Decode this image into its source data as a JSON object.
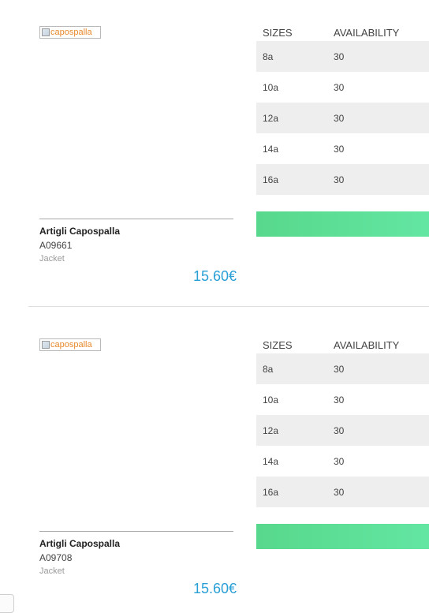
{
  "products": [
    {
      "image_alt": "capospalla",
      "table_headers": {
        "size": "SIZES",
        "availability": "AVAILABILITY"
      },
      "rows": [
        {
          "size": "8a",
          "availability": "30"
        },
        {
          "size": "10a",
          "availability": "30"
        },
        {
          "size": "12a",
          "availability": "30"
        },
        {
          "size": "14a",
          "availability": "30"
        },
        {
          "size": "16a",
          "availability": "30"
        }
      ],
      "name": "Artigli Capospalla",
      "code": "A09661",
      "category": "Jacket",
      "price": "15.60€"
    },
    {
      "image_alt": "capospalla",
      "table_headers": {
        "size": "SIZES",
        "availability": "AVAILABILITY"
      },
      "rows": [
        {
          "size": "8a",
          "availability": "30"
        },
        {
          "size": "10a",
          "availability": "30"
        },
        {
          "size": "12a",
          "availability": "30"
        },
        {
          "size": "14a",
          "availability": "30"
        },
        {
          "size": "16a",
          "availability": "30"
        }
      ],
      "name": "Artigli Capospalla",
      "code": "A09708",
      "category": "Jacket",
      "price": "15.60€"
    }
  ],
  "colors": {
    "price": "#2a9fd6",
    "order_bar": "#5ee09a",
    "row_stripe": "#eeeeee"
  }
}
